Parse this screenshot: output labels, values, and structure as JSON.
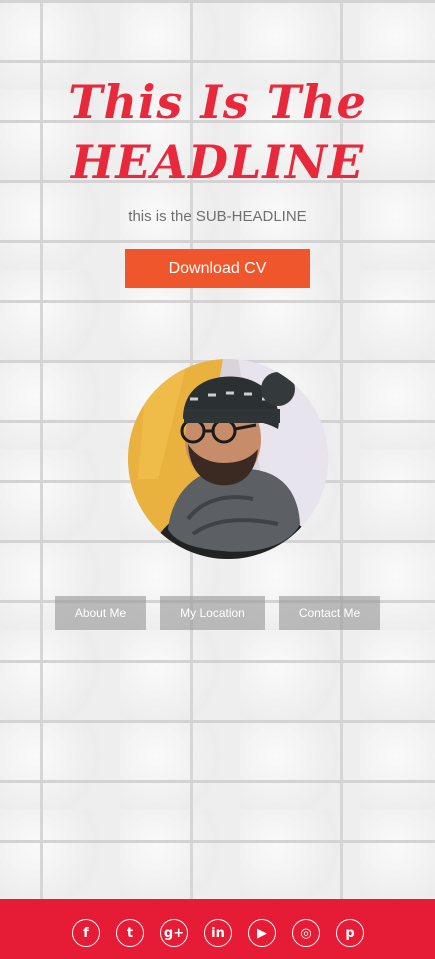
{
  "hero": {
    "headline_line1": "This Is The",
    "headline_line2": "HEADLINE",
    "subheadline": "this is the SUB-HEADLINE",
    "download_label": "Download CV"
  },
  "nav": {
    "about_label": "About Me",
    "location_label": "My Location",
    "contact_label": "Contact Me"
  },
  "footer": {
    "social": [
      {
        "name": "facebook-icon",
        "glyph": "f"
      },
      {
        "name": "twitter-icon",
        "glyph": "t"
      },
      {
        "name": "google-plus-icon",
        "glyph": "g+"
      },
      {
        "name": "linkedin-icon",
        "glyph": "in"
      },
      {
        "name": "youtube-icon",
        "glyph": "▶"
      },
      {
        "name": "instagram-icon",
        "glyph": "◎"
      },
      {
        "name": "pinterest-icon",
        "glyph": "p"
      }
    ]
  },
  "colors": {
    "accent_red": "#e8283b",
    "button_orange": "#f0562b",
    "footer_red": "#e61c36",
    "nav_gray": "#969696"
  }
}
